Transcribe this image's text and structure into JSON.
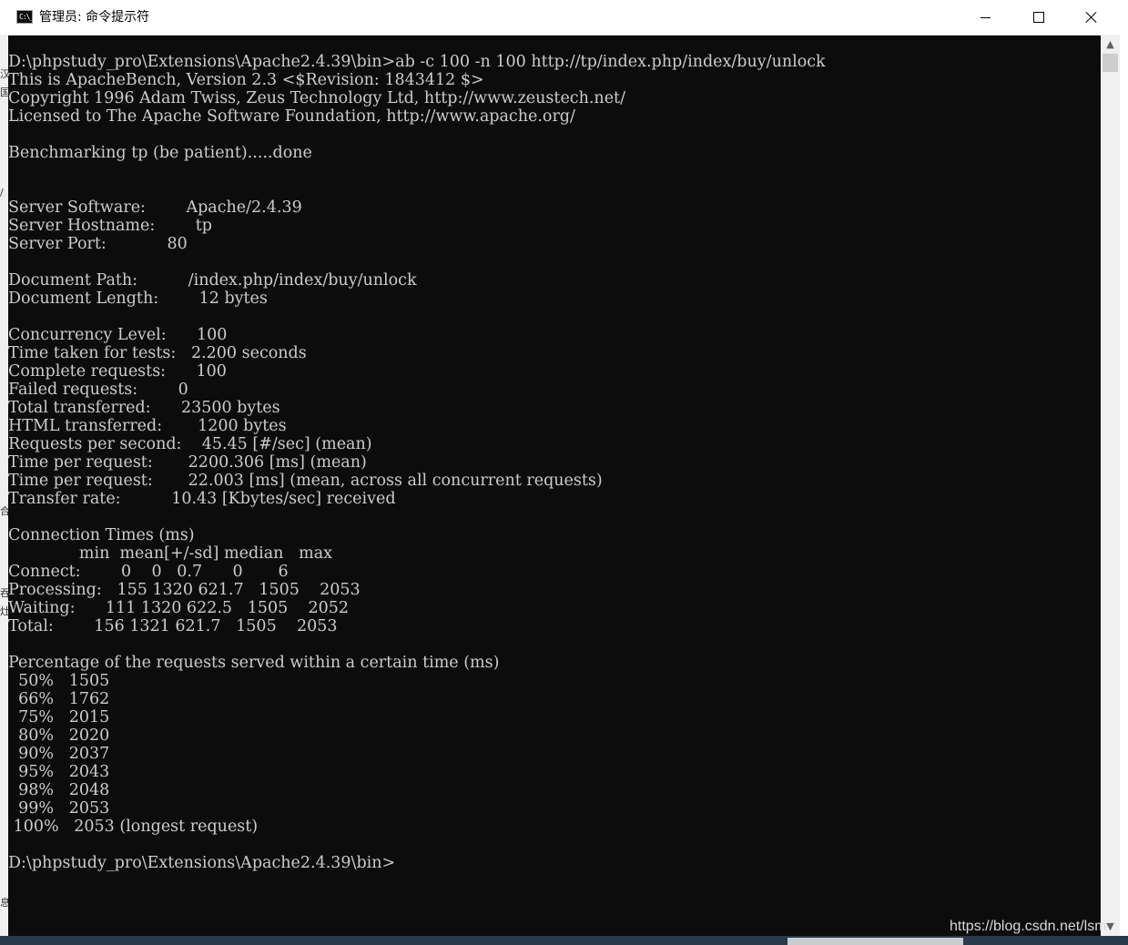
{
  "window": {
    "title": "管理员: 命令提示符",
    "icon_text": "C:\\_",
    "icon": "console-icon",
    "controls": [
      "minimize-icon",
      "maximize-icon",
      "close-icon"
    ]
  },
  "left_edge_chars": [
    "汉",
    "国",
    "/",
    "合",
    "吞",
    "灶",
    "息"
  ],
  "console": {
    "lines": [
      "D:\\phpstudy_pro\\Extensions\\Apache2.4.39\\bin>ab -c 100 -n 100 http://tp/index.php/index/buy/unlock",
      "This is ApacheBench, Version 2.3 <$Revision: 1843412 $>",
      "Copyright 1996 Adam Twiss, Zeus Technology Ltd, http://www.zeustech.net/",
      "Licensed to The Apache Software Foundation, http://www.apache.org/",
      "",
      "Benchmarking tp (be patient).....done",
      "",
      "",
      "Server Software:        Apache/2.4.39",
      "Server Hostname:        tp",
      "Server Port:            80",
      "",
      "Document Path:          /index.php/index/buy/unlock",
      "Document Length:        12 bytes",
      "",
      "Concurrency Level:      100",
      "Time taken for tests:   2.200 seconds",
      "Complete requests:      100",
      "Failed requests:        0",
      "Total transferred:      23500 bytes",
      "HTML transferred:       1200 bytes",
      "Requests per second:    45.45 [#/sec] (mean)",
      "Time per request:       2200.306 [ms] (mean)",
      "Time per request:       22.003 [ms] (mean, across all concurrent requests)",
      "Transfer rate:          10.43 [Kbytes/sec] received",
      "",
      "Connection Times (ms)",
      "              min  mean[+/-sd] median   max",
      "Connect:        0    0   0.7      0       6",
      "Processing:   155 1320 621.7   1505    2053",
      "Waiting:      111 1320 622.5   1505    2052",
      "Total:        156 1321 621.7   1505    2053",
      "",
      "Percentage of the requests served within a certain time (ms)",
      "  50%   1505",
      "  66%   1762",
      "  75%   2015",
      "  80%   2020",
      "  90%   2037",
      "  95%   2043",
      "  98%   2048",
      "  99%   2053",
      " 100%   2053 (longest request)",
      "",
      "D:\\phpstudy_pro\\Extensions\\Apache2.4.39\\bin>"
    ]
  },
  "scrollbar": {
    "up_icon": "chevron-up-icon",
    "down_icon": "chevron-down-icon"
  },
  "watermark": "https://blog.csdn.net/lsm",
  "colors": {
    "console_bg": "#0c0c0c",
    "console_fg": "#cccccc",
    "titlebar_bg": "#ffffff"
  }
}
